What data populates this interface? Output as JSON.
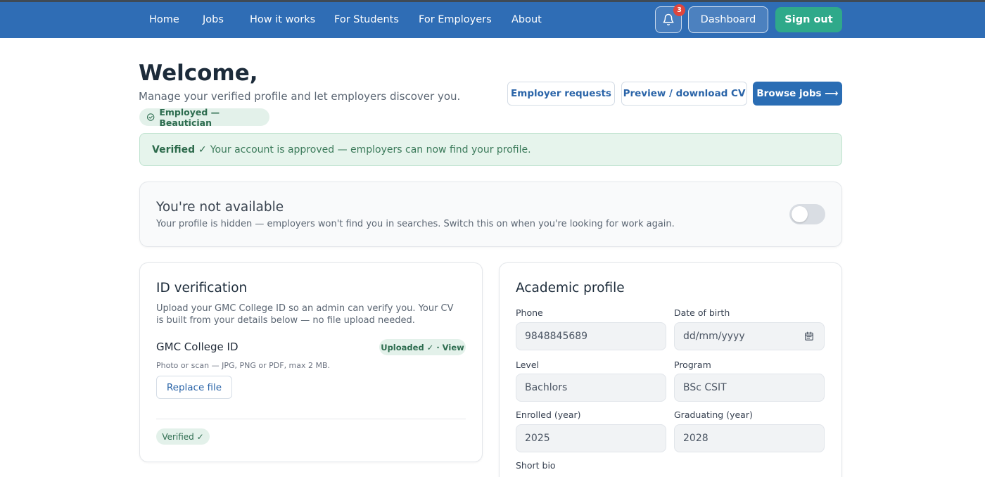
{
  "nav": {
    "links": [
      "Home",
      "Jobs",
      "How it works",
      "For Students",
      "For Employers",
      "About"
    ],
    "notification_count": "3",
    "dashboard_label": "Dashboard",
    "signout_label": "Sign out"
  },
  "header": {
    "title": "Welcome,",
    "subtitle": "Manage your verified profile and let employers discover you.",
    "status_badge": "Employed — Beautician",
    "buttons": {
      "employer_requests": "Employer requests",
      "preview_cv": "Preview / download CV",
      "browse_jobs": "Browse jobs ⟶"
    }
  },
  "banner": {
    "strong": "Verified ✓",
    "text": "Your account is approved — employers can now find your profile."
  },
  "availability": {
    "title": "You're not available",
    "description": "Your profile is hidden — employers won't find you in searches. Switch this on when you're looking for work again.",
    "toggle_on": false
  },
  "id_verification": {
    "title": "ID verification",
    "description": "Upload your GMC College ID so an admin can verify you. Your CV is built from your details below — no file upload needed.",
    "document_label": "GMC College ID",
    "uploaded_badge": "Uploaded ✓ · View",
    "hint": "Photo or scan — JPG, PNG or PDF, max 2 MB.",
    "replace_label": "Replace file",
    "verified_badge": "Verified ✓"
  },
  "academic": {
    "title": "Academic profile",
    "fields": {
      "phone": {
        "label": "Phone",
        "value": "9848845689"
      },
      "dob": {
        "label": "Date of birth",
        "placeholder": "dd/mm/yyyy"
      },
      "level": {
        "label": "Level",
        "value": "Bachlors"
      },
      "program": {
        "label": "Program",
        "value": "BSc CSIT"
      },
      "enrolled": {
        "label": "Enrolled (year)",
        "value": "2025"
      },
      "graduating": {
        "label": "Graduating (year)",
        "value": "2028"
      },
      "bio": {
        "label": "Short bio"
      }
    }
  },
  "colors": {
    "nav_bg": "#2f6db5",
    "accent_green": "#2fa98a",
    "primary_blue": "#2a6db4",
    "success_bg": "#e6f4ec"
  }
}
